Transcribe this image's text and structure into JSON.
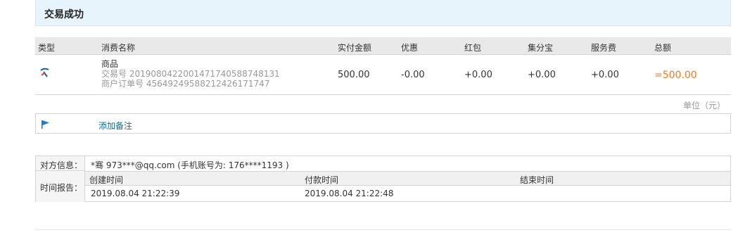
{
  "header": {
    "title": "交易成功"
  },
  "table": {
    "columns": {
      "type": "类型",
      "name": "消费名称",
      "actual": "实付金额",
      "discount": "优惠",
      "hongbao": "红包",
      "jifenbao": "集分宝",
      "fee": "服务费",
      "total": "总额"
    },
    "row": {
      "icon": "transfer-icon",
      "goods": "商品",
      "trade_no_label": "交易号",
      "trade_no": "20190804220014717405887481 31",
      "trade_no_text": "2019080422001471740588748131",
      "merchant_no_label": "商户订单号",
      "merchant_no": "4564924958821242617174 7",
      "merchant_no_text": "45649249588212426171747",
      "actual": "500.00",
      "discount": "-0.00",
      "hongbao": "+0.00",
      "jifenbao": "+0.00",
      "fee": "+0.00",
      "total": "=500.00"
    },
    "unit": "单位（元）"
  },
  "note": {
    "flag_icon": "flag-icon",
    "add_note": "添加备注"
  },
  "info": {
    "counterpart_label": "对方信息：",
    "counterpart_value": "*骞 973***@qq.com (手机账号为: 176****1193 )",
    "time_label": "时间报告：",
    "time_headers": [
      "创建时间",
      "付款时间",
      "结束时间"
    ],
    "time_values": [
      "2019.08.04 21:22:39",
      "2019.08.04 21:22:48",
      ""
    ]
  },
  "colors": {
    "accent": "#f37b1d",
    "link": "#0a6fa0",
    "header_bg": "#e8f4fc"
  }
}
